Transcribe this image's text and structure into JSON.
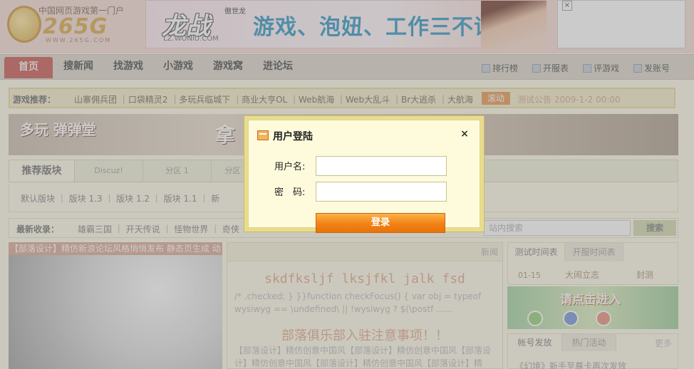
{
  "header": {
    "slogan": "中国网页游戏第一门户",
    "logo_text": "265G",
    "logo_url": "WWW.265G.COM",
    "ad": {
      "brand": "龙战",
      "brand_small": "傲世龙",
      "brand_url": "LZ.WONIU.COM",
      "slogan": "游戏、泡妞、工作三不误"
    },
    "close_glyph": "×"
  },
  "nav": {
    "items": [
      "首页",
      "搜新闻",
      "找游戏",
      "小游戏",
      "游戏窝",
      "进论坛"
    ],
    "tools": [
      "排行榜",
      "开服表",
      "评游戏",
      "发账号"
    ]
  },
  "recommend": {
    "label": "游戏推荐：",
    "games": "山寨佣兵团 ｜口袋精灵2 ｜多玩兵临城下 ｜商业大亨OL ｜Web航海 ｜Web大乱斗 ｜Br大逃杀 ｜大航海",
    "scroll_label": "滚动",
    "notice": "测试公告 2009-1-2 00:00"
  },
  "banner": {
    "left_text": "多玩 弹弹堂",
    "right_text": "拿"
  },
  "forum_tabs": [
    "推荐版块",
    "Discuz!",
    "分区 1",
    "分区"
  ],
  "sub_items": "默认版块  ｜  版块 1.3  ｜  版块 1.2  ｜  版块 1.1  ｜  新",
  "new_row": {
    "label": "最新收录：",
    "items": "雄霸三国  ｜  开天传说  ｜  怪物世界  ｜  奇侠",
    "search_placeholder": "站内搜索",
    "search_button": "搜索"
  },
  "left_image": {
    "caption": "【部落设计】精仿新浪论坛风格悄悄发布 静态页生成 动"
  },
  "middle": {
    "more": "新闻",
    "heading1": "skdfksljf lksjfkl jalk fsd",
    "para1": "/* .checked; } }}function checkFocus() { var obj = typeof wysiwyg == \\undefined\\ || !wysiwyg ? $(\\postf ......",
    "heading2": "部落俱乐部入驻注意事项！！",
    "para2": "【部落设计】精仿创意中国风【部落设计】精仿创意中国风【部落设计】精仿创意中国风【部落设计】精仿创意中国风【部落设计】精"
  },
  "right_panel": {
    "tabs": [
      "测试时间表",
      "开服时间表"
    ],
    "row": {
      "date": "01-15",
      "game": "大闹立志",
      "status": "封测"
    },
    "ad_text": "请点击进入",
    "tabs2": [
      "帐号发放",
      "热门活动"
    ],
    "more": "更多",
    "item": "《幻境》新手至尊卡再次发放"
  },
  "dialog": {
    "title": "用户登陆",
    "close": "×",
    "username_label": "用户名:",
    "password_label": "密　码:",
    "login_button": "登录"
  },
  "colors": {
    "overlay": "#8c8c8c",
    "dialog_border": "#e8dc91",
    "login_button": "#f28518",
    "nav_active": "#c54b45"
  }
}
